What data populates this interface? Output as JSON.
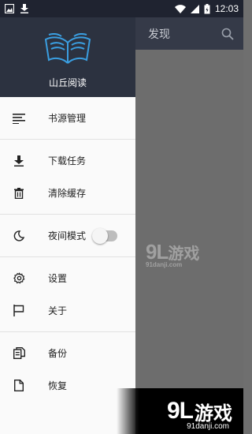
{
  "status_bar": {
    "time": "12:03"
  },
  "app_bar": {
    "title": "发现"
  },
  "drawer": {
    "app_name": "山丘阅读",
    "groups": [
      [
        {
          "label": "书源管理",
          "icon": "list-icon"
        }
      ],
      [
        {
          "label": "下载任务",
          "icon": "download-icon"
        },
        {
          "label": "清除缓存",
          "icon": "trash-icon"
        }
      ],
      [
        {
          "label": "夜间模式",
          "icon": "moon-icon",
          "toggle": false
        }
      ],
      [
        {
          "label": "设置",
          "icon": "gear-icon"
        },
        {
          "label": "关于",
          "icon": "flag-icon"
        }
      ],
      [
        {
          "label": "备份",
          "icon": "copy-icon"
        },
        {
          "label": "恢复",
          "icon": "file-icon"
        }
      ]
    ]
  },
  "watermark": {
    "brand": "9L",
    "brand_cn": "游戏",
    "site": "91danji.com"
  },
  "banner": {
    "brand": "9L",
    "brand_cn": "游戏",
    "site": "91danji.com"
  }
}
